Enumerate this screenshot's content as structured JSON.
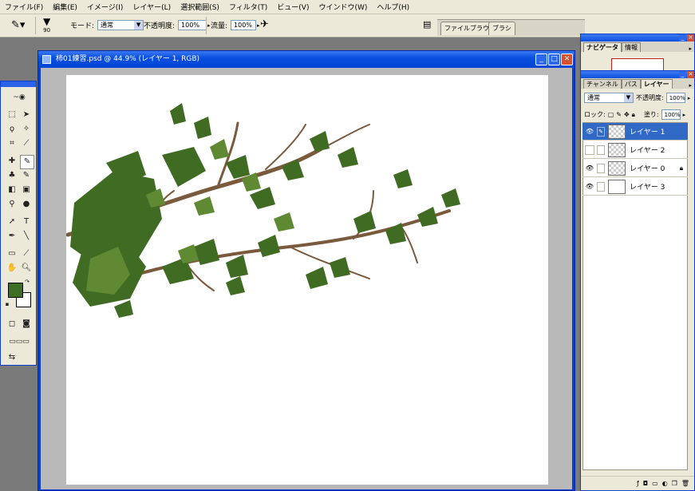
{
  "menu": [
    "ファイル(F)",
    "編集(E)",
    "イメージ(I)",
    "レイヤー(L)",
    "選択範囲(S)",
    "フィルタ(T)",
    "ビュー(V)",
    "ウインドウ(W)",
    "ヘルプ(H)"
  ],
  "options": {
    "brush_size": "90",
    "mode_label": "モード:",
    "mode_value": "通常",
    "opacity_label": "不透明度:",
    "opacity_value": "100%",
    "flow_label": "流量:",
    "flow_value": "100%",
    "well_tabs": [
      "ファイルブラウザ",
      "ブラシ"
    ]
  },
  "document": {
    "title": "柿01練習.psd @ 44.9% (レイヤー 1, RGB)"
  },
  "navigator_panel": {
    "tabs": [
      "ナビゲータ",
      "情報"
    ]
  },
  "layers_panel": {
    "tabs": [
      "チャンネル",
      "パス",
      "レイヤー"
    ],
    "blend_mode": "通常",
    "opacity_label": "不透明度:",
    "opacity_value": "100%",
    "lock_label": "ロック:",
    "fill_label": "塗り:",
    "fill_value": "100%",
    "layers": [
      {
        "name": "レイヤー 1",
        "selected": true,
        "visible": true
      },
      {
        "name": "レイヤー 2",
        "selected": false,
        "visible": false
      },
      {
        "name": "レイヤー 0",
        "selected": false,
        "visible": true,
        "locked": true
      },
      {
        "name": "レイヤー 3",
        "selected": false,
        "visible": true
      }
    ]
  },
  "colors": {
    "foreground": "#3c6e24",
    "background": "#ffffff",
    "leaf_dark": "#3f6b22",
    "leaf_light": "#5f8a33",
    "branch": "#7a5a3c"
  }
}
